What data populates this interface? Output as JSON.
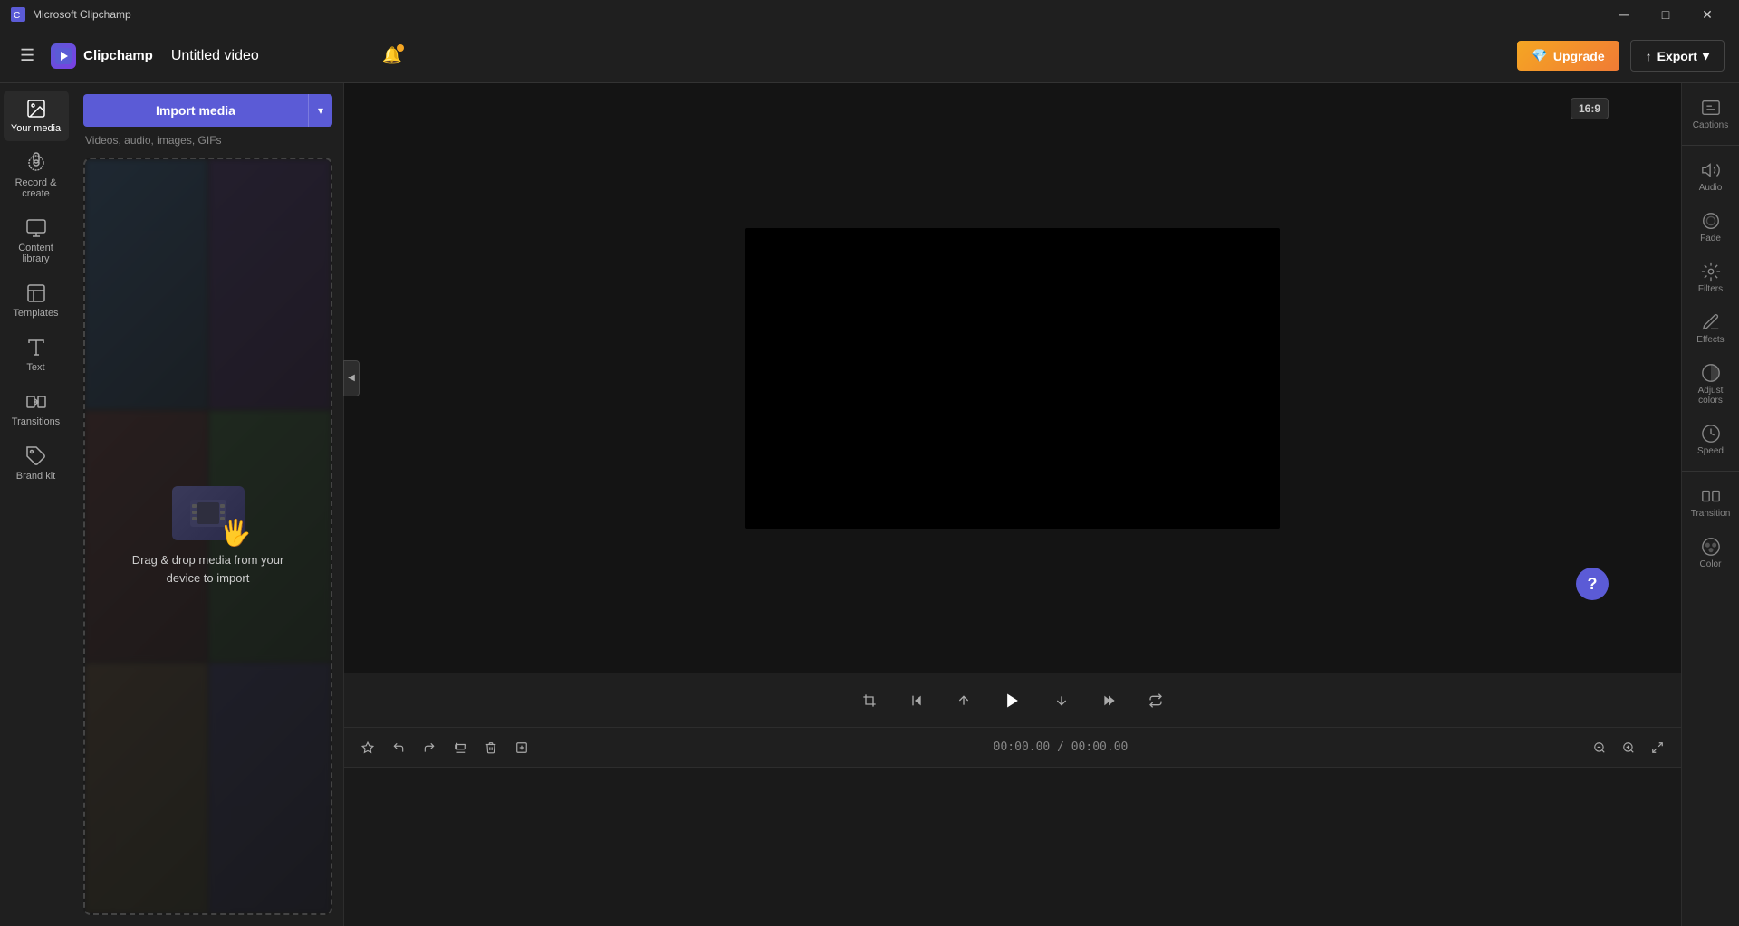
{
  "titlebar": {
    "icon": "🎬",
    "title": "Microsoft Clipchamp",
    "minimize": "─",
    "maximize": "□",
    "close": "✕"
  },
  "topbar": {
    "hamburger": "☰",
    "logo": "🎬",
    "logo_text": "Clipchamp",
    "video_title": "Untitled video",
    "notification_icon": "🔔",
    "upgrade_label": "Upgrade",
    "upgrade_icon": "💎",
    "export_label": "Export",
    "export_icon": "↑"
  },
  "sidebar": {
    "items": [
      {
        "id": "your-media",
        "label": "Your media",
        "icon": "🖼"
      },
      {
        "id": "record-create",
        "label": "Record & create",
        "icon": "⏺"
      },
      {
        "id": "content-library",
        "label": "Content library",
        "icon": "🎞"
      },
      {
        "id": "templates",
        "label": "Templates",
        "icon": "⬜"
      },
      {
        "id": "text",
        "label": "Text",
        "icon": "T"
      },
      {
        "id": "transitions",
        "label": "Transitions",
        "icon": "↔"
      },
      {
        "id": "brand-kit",
        "label": "Brand kit",
        "icon": "🏷"
      }
    ]
  },
  "media_panel": {
    "import_button": "Import media",
    "import_arrow": "▾",
    "subtitle": "Videos, audio, images, GIFs",
    "drop_text": "Drag & drop media from your device to import"
  },
  "preview": {
    "aspect_ratio": "16:9",
    "captions_label": "Captions"
  },
  "playback": {
    "rewind": "⏮",
    "step_back": "⏪",
    "play": "▶",
    "step_forward": "⏩",
    "fast_forward": "⏭",
    "loop": "🔁",
    "crop": "⛶",
    "timestamp": "00:00.00 / 00:00.00"
  },
  "timeline": {
    "undo": "↩",
    "redo": "↪",
    "split": "✂",
    "delete": "🗑",
    "add": "⊕",
    "zoom_in": "+",
    "zoom_out": "−",
    "fit": "⤢",
    "time_display": "00:00.00 / 00:00.00"
  },
  "right_panel": {
    "items": [
      {
        "id": "audio",
        "label": "Audio",
        "icon": "🔊"
      },
      {
        "id": "fade",
        "label": "Fade",
        "icon": "◎"
      },
      {
        "id": "filters",
        "label": "Filters",
        "icon": "✦"
      },
      {
        "id": "effects",
        "label": "Effects",
        "icon": "✏"
      },
      {
        "id": "adjust-colors",
        "label": "Adjust colors",
        "icon": "◑"
      },
      {
        "id": "speed",
        "label": "Speed",
        "icon": "⏱"
      },
      {
        "id": "transition",
        "label": "Transition",
        "icon": "⬛"
      },
      {
        "id": "color",
        "label": "Color",
        "icon": "🎨"
      }
    ]
  },
  "help": {
    "label": "?"
  }
}
